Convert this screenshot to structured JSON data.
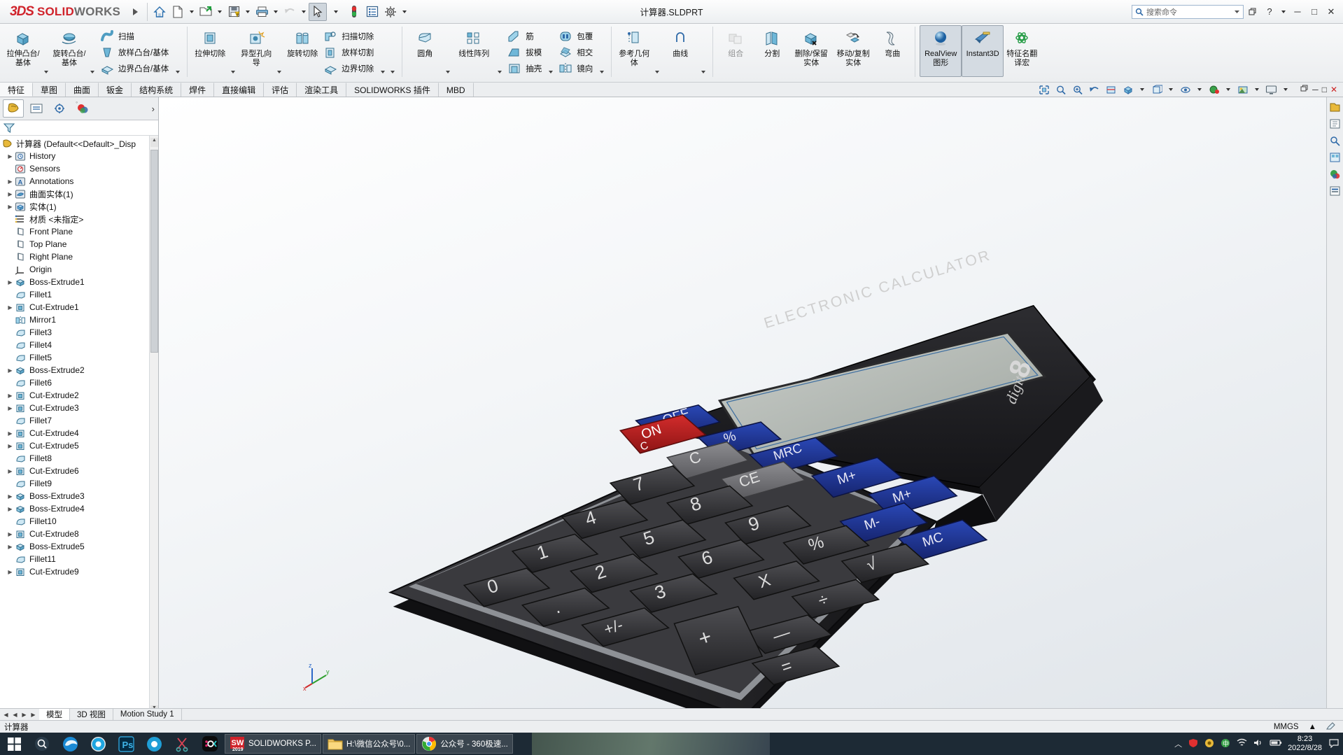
{
  "titlebar": {
    "brand_3ds": "3DS",
    "brand_solid": "SOLID",
    "brand_works": "WORKS",
    "document_title": "计算器.SLDPRT",
    "icons": [
      "home-icon",
      "new-document-icon",
      "open-folder-icon",
      "save-icon",
      "print-icon",
      "undo-icon",
      "select-arrow-icon",
      "rebuild-icon",
      "options-list-icon",
      "gear-icon"
    ],
    "search_placeholder": "搜索命令",
    "help_label": "?",
    "minimize": "─",
    "maximize": "□",
    "close": "✕"
  },
  "ribbon": {
    "groups": [
      {
        "name": "boss-base",
        "big": [
          {
            "label": "拉伸凸台/基体",
            "icon": "extrude-boss-icon",
            "dropdown": true
          },
          {
            "label": "旋转凸台/基体",
            "icon": "revolve-boss-icon",
            "dropdown": true
          }
        ],
        "small": [
          {
            "label": "扫描",
            "icon": "sweep-icon"
          },
          {
            "label": "放样凸台/基体",
            "icon": "loft-boss-icon"
          },
          {
            "label": "边界凸台/基体",
            "icon": "boundary-boss-icon"
          }
        ],
        "small_dropdown": true
      },
      {
        "name": "cut",
        "big": [
          {
            "label": "拉伸切除",
            "icon": "extrude-cut-icon",
            "dropdown": true
          },
          {
            "label": "异型孔向导",
            "icon": "hole-wizard-icon",
            "dropdown": true
          },
          {
            "label": "旋转切除",
            "icon": "revolve-cut-icon",
            "dropdown": false
          }
        ],
        "small": [
          {
            "label": "扫描切除",
            "icon": "sweep-cut-icon"
          },
          {
            "label": "放样切割",
            "icon": "loft-cut-icon"
          },
          {
            "label": "边界切除",
            "icon": "boundary-cut-icon"
          }
        ],
        "small_dropdown": true
      },
      {
        "name": "features",
        "big": [
          {
            "label": "圆角",
            "icon": "fillet-icon",
            "dropdown": true
          },
          {
            "label": "线性阵列",
            "icon": "linear-pattern-icon",
            "dropdown": true
          }
        ],
        "small": [
          {
            "label": "筋",
            "icon": "rib-icon"
          },
          {
            "label": "拔模",
            "icon": "draft-icon"
          },
          {
            "label": "抽壳",
            "icon": "shell-icon"
          }
        ],
        "small2": [
          {
            "label": "包覆",
            "icon": "wrap-icon"
          },
          {
            "label": "相交",
            "icon": "intersect-icon"
          },
          {
            "label": "镜向",
            "icon": "mirror-icon"
          }
        ],
        "small_dropdown": true
      },
      {
        "name": "reference",
        "big": [
          {
            "label": "参考几何体",
            "icon": "reference-geometry-icon",
            "dropdown": true
          },
          {
            "label": "曲线",
            "icon": "curves-icon",
            "dropdown": true
          }
        ]
      },
      {
        "name": "bodies",
        "big": [
          {
            "label": "组合",
            "icon": "combine-icon",
            "disabled": true
          },
          {
            "label": "分割",
            "icon": "split-icon"
          },
          {
            "label": "删除/保留实体",
            "icon": "delete-keep-body-icon"
          },
          {
            "label": "移动/复制实体",
            "icon": "move-copy-body-icon"
          },
          {
            "label": "弯曲",
            "icon": "deform-icon"
          }
        ]
      },
      {
        "name": "display",
        "big": [
          {
            "label": "RealView 图形",
            "icon": "realview-sphere-icon",
            "selected": true
          },
          {
            "label": "Instant3D",
            "icon": "instant3d-icon",
            "selected": true
          },
          {
            "label": "特征名翻译宏",
            "icon": "macro-green-icon"
          }
        ]
      }
    ]
  },
  "tabs": {
    "items": [
      {
        "label": "特征",
        "active": true
      },
      {
        "label": "草图",
        "active": false
      },
      {
        "label": "曲面",
        "active": false
      },
      {
        "label": "钣金",
        "active": false
      },
      {
        "label": "结构系统",
        "active": false
      },
      {
        "label": "焊件",
        "active": false
      },
      {
        "label": "直接编辑",
        "active": false
      },
      {
        "label": "评估",
        "active": false
      },
      {
        "label": "渲染工具",
        "active": false
      },
      {
        "label": "SOLIDWORKS 插件",
        "active": false
      },
      {
        "label": "MBD",
        "active": false
      }
    ],
    "view_icons": [
      "zoom-fit-icon",
      "zoom-area-icon",
      "zoom-in-out-icon",
      "previous-view-icon",
      "section-view-icon",
      "view-orientation-icon",
      "display-style-icon",
      "hide-show-icon",
      "edit-appearance-icon",
      "apply-scene-icon",
      "view-settings-icon"
    ],
    "window_controls": [
      "restore-icon",
      "minimize-icon",
      "maximize-icon",
      "close-icon"
    ]
  },
  "feature_manager": {
    "tab_icons": [
      "feature-tree-icon",
      "property-manager-icon",
      "configuration-manager-icon",
      "display-manager-icon"
    ],
    "expand_arrow": "›",
    "filter_icon": "filter-icon",
    "root": "计算器  (Default<<Default>_Disp",
    "tree": [
      {
        "label": "History",
        "icon": "history-icon",
        "arrow": true,
        "indent": 1
      },
      {
        "label": "Sensors",
        "icon": "sensors-icon",
        "arrow": false,
        "indent": 1
      },
      {
        "label": "Annotations",
        "icon": "annotations-icon",
        "arrow": true,
        "indent": 1
      },
      {
        "label": "曲面实体(1)",
        "icon": "surface-bodies-icon",
        "arrow": true,
        "indent": 1
      },
      {
        "label": "实体(1)",
        "icon": "solid-bodies-icon",
        "arrow": true,
        "indent": 1
      },
      {
        "label": "材质 <未指定>",
        "icon": "material-icon",
        "arrow": false,
        "indent": 1
      },
      {
        "label": "Front Plane",
        "icon": "plane-icon",
        "arrow": false,
        "indent": 1
      },
      {
        "label": "Top Plane",
        "icon": "plane-icon",
        "arrow": false,
        "indent": 1
      },
      {
        "label": "Right Plane",
        "icon": "plane-icon",
        "arrow": false,
        "indent": 1
      },
      {
        "label": "Origin",
        "icon": "origin-icon",
        "arrow": false,
        "indent": 1
      },
      {
        "label": "Boss-Extrude1",
        "icon": "feature-icon",
        "arrow": true,
        "indent": 1
      },
      {
        "label": "Fillet1",
        "icon": "fillet-feature-icon",
        "arrow": false,
        "indent": 1
      },
      {
        "label": "Cut-Extrude1",
        "icon": "cut-feature-icon",
        "arrow": true,
        "indent": 1
      },
      {
        "label": "Mirror1",
        "icon": "mirror-feature-icon",
        "arrow": false,
        "indent": 1
      },
      {
        "label": "Fillet3",
        "icon": "fillet-feature-icon",
        "arrow": false,
        "indent": 1
      },
      {
        "label": "Fillet4",
        "icon": "fillet-feature-icon",
        "arrow": false,
        "indent": 1
      },
      {
        "label": "Fillet5",
        "icon": "fillet-feature-icon",
        "arrow": false,
        "indent": 1
      },
      {
        "label": "Boss-Extrude2",
        "icon": "feature-icon",
        "arrow": true,
        "indent": 1
      },
      {
        "label": "Fillet6",
        "icon": "fillet-feature-icon",
        "arrow": false,
        "indent": 1
      },
      {
        "label": "Cut-Extrude2",
        "icon": "cut-feature-icon",
        "arrow": true,
        "indent": 1
      },
      {
        "label": "Cut-Extrude3",
        "icon": "cut-feature-icon",
        "arrow": true,
        "indent": 1
      },
      {
        "label": "Fillet7",
        "icon": "fillet-feature-icon",
        "arrow": false,
        "indent": 1
      },
      {
        "label": "Cut-Extrude4",
        "icon": "cut-feature-icon",
        "arrow": true,
        "indent": 1
      },
      {
        "label": "Cut-Extrude5",
        "icon": "cut-feature-icon",
        "arrow": true,
        "indent": 1
      },
      {
        "label": "Fillet8",
        "icon": "fillet-feature-icon",
        "arrow": false,
        "indent": 1
      },
      {
        "label": "Cut-Extrude6",
        "icon": "cut-feature-icon",
        "arrow": true,
        "indent": 1
      },
      {
        "label": "Fillet9",
        "icon": "fillet-feature-icon",
        "arrow": false,
        "indent": 1
      },
      {
        "label": "Boss-Extrude3",
        "icon": "feature-icon",
        "arrow": true,
        "indent": 1
      },
      {
        "label": "Boss-Extrude4",
        "icon": "feature-icon",
        "arrow": true,
        "indent": 1
      },
      {
        "label": "Fillet10",
        "icon": "fillet-feature-icon",
        "arrow": false,
        "indent": 1
      },
      {
        "label": "Cut-Extrude8",
        "icon": "cut-feature-icon",
        "arrow": true,
        "indent": 1
      },
      {
        "label": "Boss-Extrude5",
        "icon": "feature-icon",
        "arrow": true,
        "indent": 1
      },
      {
        "label": "Fillet11",
        "icon": "fillet-feature-icon",
        "arrow": false,
        "indent": 1
      },
      {
        "label": "Cut-Extrude9",
        "icon": "cut-feature-icon",
        "arrow": true,
        "indent": 1
      }
    ]
  },
  "model": {
    "brand_text": "ELECTRONIC CALCULATOR",
    "digit_text": "8",
    "digit_label": "digit",
    "keys_blue_top": [
      "OFF",
      "%",
      "MRC"
    ],
    "key_on": "ON C",
    "keys_gray": [
      "C",
      "CE"
    ],
    "keys_blue_right": [
      "M+",
      "M-",
      "MC",
      "M+"
    ],
    "keypad_digits": [
      "7",
      "8",
      "9",
      "4",
      "5",
      "6",
      "1",
      "2",
      "3",
      "0",
      ".",
      "+/-"
    ],
    "keys_ops": [
      "%",
      "×",
      "÷",
      "√",
      "+",
      "−",
      "="
    ]
  },
  "model_tabs": {
    "items": [
      {
        "label": "模型",
        "active": true
      },
      {
        "label": "3D 视图",
        "active": false
      },
      {
        "label": "Motion Study 1",
        "active": false
      }
    ]
  },
  "status": {
    "left": "计算器",
    "units": "MMGS",
    "units_caret": "▲",
    "editing_icon": "edit-icon"
  },
  "taskbar": {
    "start_icon": "windows-start-icon",
    "pinned": [
      "search-circle-icon",
      "edge-icon",
      "chrome-circle-icon",
      "photoshop-icon",
      "recorder-icon",
      "snip-icon",
      "okc-icon"
    ],
    "tasks": [
      {
        "label": "SOLIDWORKS P...",
        "icon": "solidworks-2019-icon"
      },
      {
        "label": "H:\\微信公众号\\0...",
        "icon": "folder-icon"
      },
      {
        "label": "公众号 - 360极速...",
        "icon": "chrome-icon"
      }
    ],
    "tray": [
      "up-arrow-icon",
      "red-shield-icon",
      "battery-icon",
      "network-icon",
      "volume-icon",
      "ime-icon"
    ],
    "time": "8:23",
    "date": "2022/8/28",
    "notify_icon": "notification-icon"
  },
  "colors": {
    "brand_red": "#d0232b",
    "ribbon_bg": "#eceef0",
    "accent_blue": "#1f4fa8",
    "taskbar_bg": "#1d2a35"
  }
}
